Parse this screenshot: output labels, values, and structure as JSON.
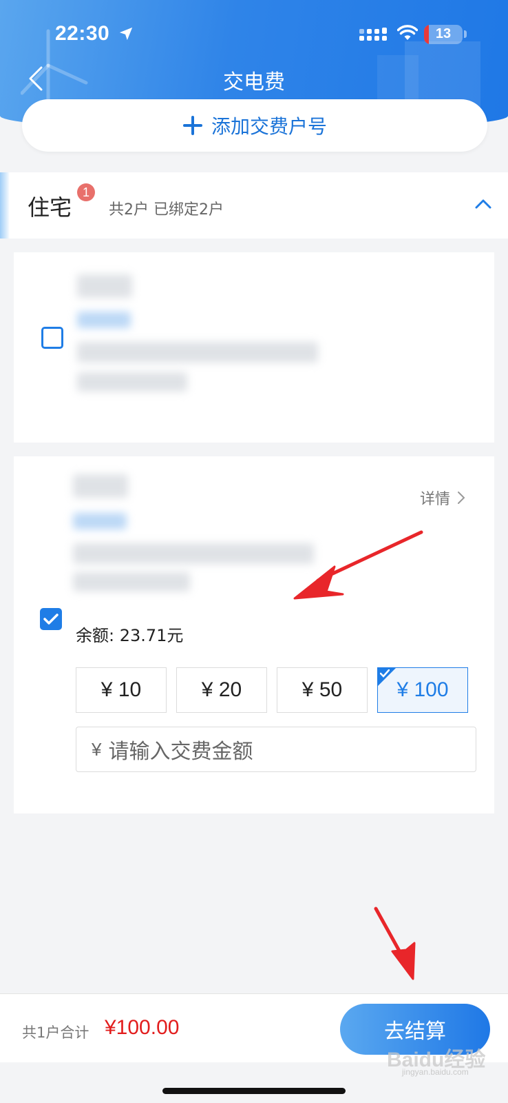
{
  "status_bar": {
    "time": "22:30",
    "battery": "13"
  },
  "header": {
    "title": "交电费"
  },
  "add_account": {
    "label": "添加交费户号"
  },
  "group": {
    "title": "住宅",
    "badge": "1",
    "summary": "共2户 已绑定2户"
  },
  "account_card_1": {
    "checked": false
  },
  "account_card_2": {
    "checked": true,
    "detail_label": "详情",
    "balance_label": "余额: 23.71元",
    "amount_options": [
      {
        "label": "¥ 10",
        "selected": false
      },
      {
        "label": "¥ 20",
        "selected": false
      },
      {
        "label": "¥ 50",
        "selected": false
      },
      {
        "label": "¥ 100",
        "selected": true
      }
    ],
    "custom_amount": {
      "currency": "¥",
      "placeholder": "请输入交费金额"
    }
  },
  "footer": {
    "summary_label": "共1户合计",
    "total": "¥100.00",
    "checkout_label": "去结算"
  },
  "watermark": {
    "text": "Baidu经验",
    "sub": "jingyan.baidu.com"
  },
  "colors": {
    "primary": "#1f7de6",
    "price": "#e21d1d",
    "badge": "#e8706b"
  }
}
